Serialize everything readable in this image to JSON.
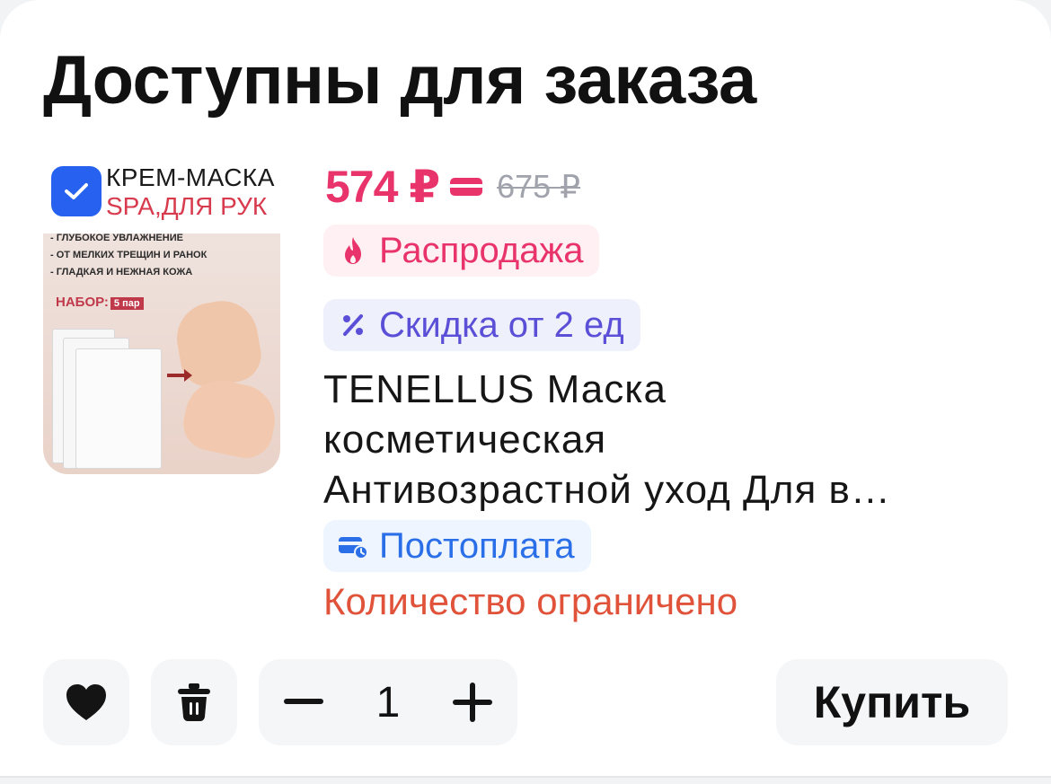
{
  "section": {
    "title": "Доступны для заказа"
  },
  "product": {
    "image": {
      "title_line1": "КРЕМ-МАСКА",
      "title_line2": "SPA,ДЛЯ РУК",
      "bullets": [
        "- ГЛУБОКОЕ УВЛАЖНЕНИЕ",
        "- ОТ МЕЛКИХ ТРЕЩИН И РАНОК",
        "- ГЛАДКАЯ И НЕЖНАЯ КОЖА"
      ],
      "set_label": "НАБОР:",
      "set_badge": "5 пар"
    },
    "selected": true,
    "price": "574 ₽",
    "old_price": "675 ₽",
    "sale_badge": "Распродажа",
    "discount_badge": "Скидка от 2 ед",
    "name_lines": [
      "TENELLUS Маска",
      "косметическая",
      "Антивозрастной уход Для в…"
    ],
    "postpay_badge": "Постоплата",
    "stock_note": "Количество ограничено"
  },
  "actions": {
    "quantity": "1",
    "buy_label": "Купить"
  },
  "colors": {
    "accent_blue": "#2761f0",
    "price_pink": "#e8336b",
    "discount_purple": "#5b4fd8",
    "postpay_blue": "#2a6ee8",
    "warning_orange": "#e0533a"
  },
  "icons": [
    "check-icon",
    "wallet-icon",
    "flame-icon",
    "percent-icon",
    "card-clock-icon",
    "heart-icon",
    "trash-icon",
    "minus-icon",
    "plus-icon"
  ]
}
